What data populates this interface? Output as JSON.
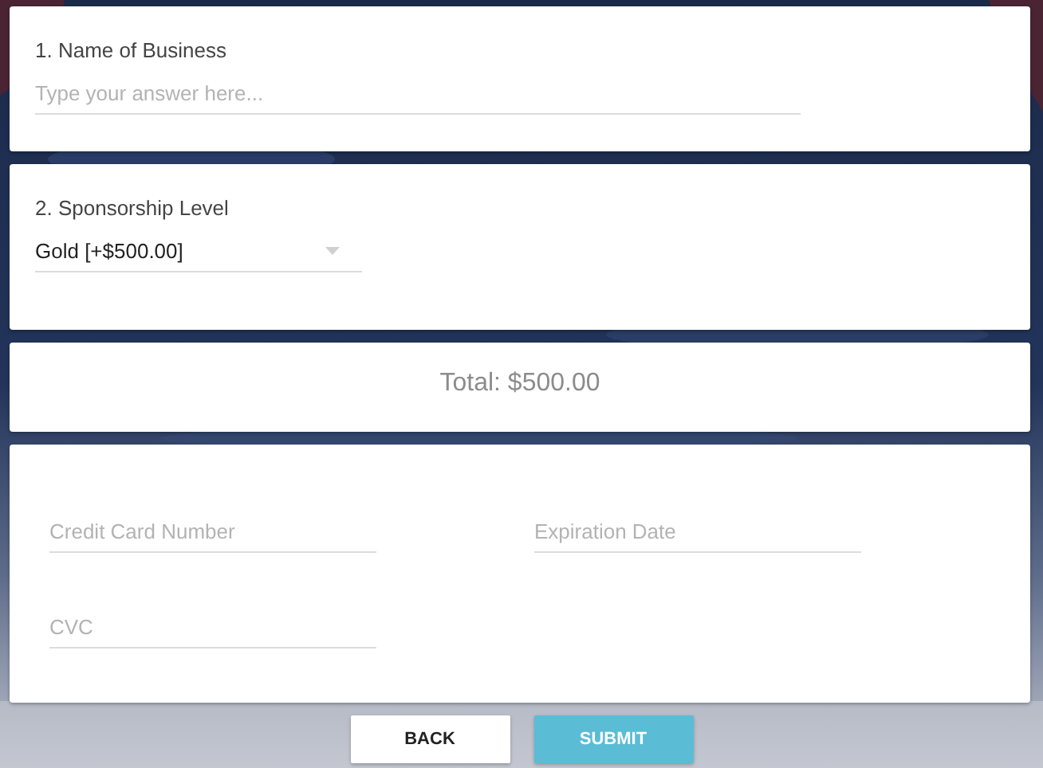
{
  "questions": [
    {
      "kind": "text",
      "label": "1. Name of Business",
      "placeholder": "Type your answer here..."
    },
    {
      "kind": "select",
      "label": "2. Sponsorship Level",
      "value": "Gold [+$500.00]"
    }
  ],
  "total": "Total: $500.00",
  "payment": {
    "fields": [
      {
        "placeholder": "Credit Card Number"
      },
      {
        "placeholder": "Expiration Date"
      },
      {
        "placeholder": "CVC"
      }
    ]
  },
  "buttons": [
    {
      "label": "BACK",
      "kind": "secondary"
    },
    {
      "label": "SUBMIT",
      "kind": "primary"
    }
  ]
}
